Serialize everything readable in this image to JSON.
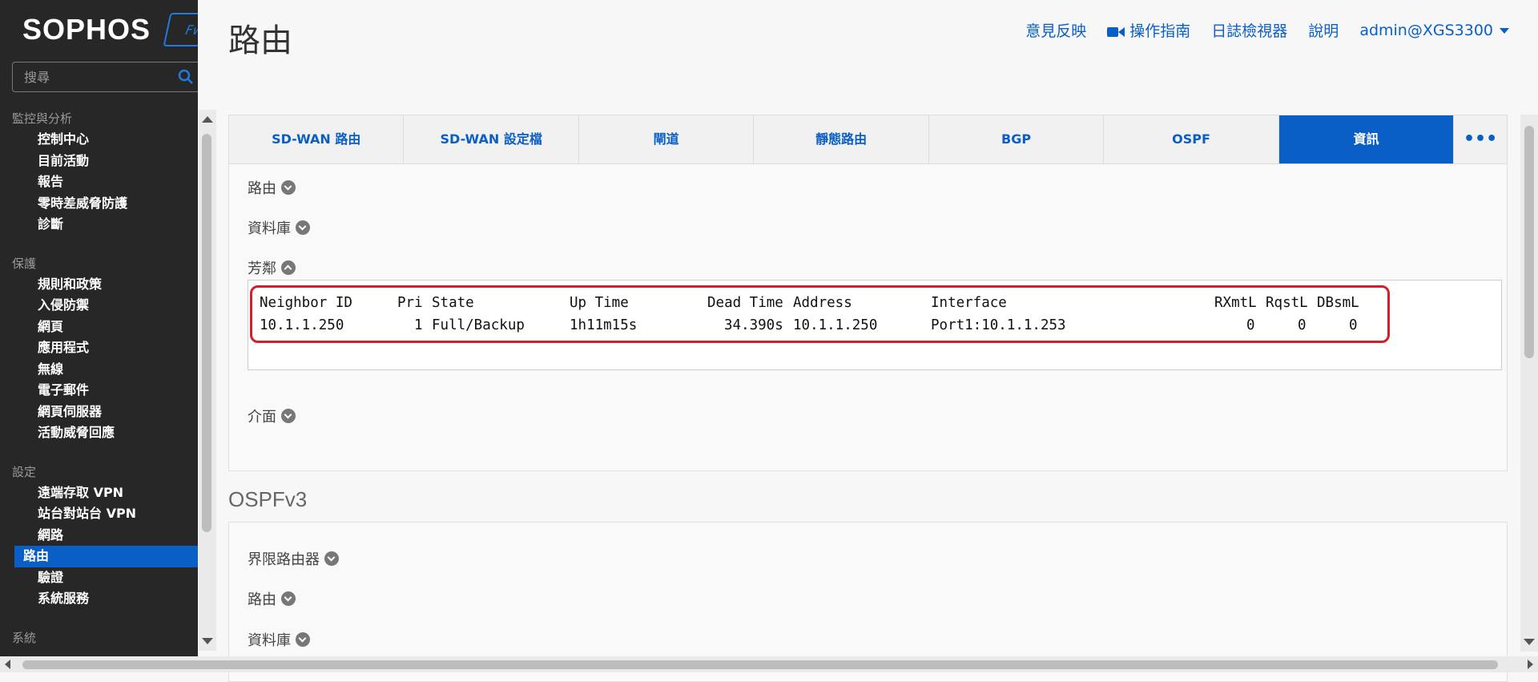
{
  "brand": {
    "name": "SOPHOS",
    "badge": "Fw"
  },
  "search": {
    "placeholder": "搜尋"
  },
  "sidebar": {
    "sections": [
      {
        "title": "監控與分析",
        "items": [
          "控制中心",
          "目前活動",
          "報告",
          "零時差威脅防護",
          "診斷"
        ]
      },
      {
        "title": "保護",
        "items": [
          "規則和政策",
          "入侵防禦",
          "網頁",
          "應用程式",
          "無線",
          "電子郵件",
          "網頁伺服器",
          "活動威脅回應"
        ]
      },
      {
        "title": "設定",
        "items": [
          "遠端存取 VPN",
          "站台對站台 VPN",
          "網路",
          "路由",
          "驗證",
          "系統服務"
        ]
      },
      {
        "title": "系統",
        "items": []
      }
    ],
    "active_item": "路由"
  },
  "header": {
    "title": "路由",
    "links": {
      "feedback": "意見反映",
      "guide": "操作指南",
      "log_viewer": "日誌檢視器",
      "help": "說明",
      "user": "admin@XGS3300"
    }
  },
  "tabs": [
    "SD-WAN 路由",
    "SD-WAN 設定檔",
    "閘道",
    "靜態路由",
    "BGP",
    "OSPF",
    "資訊"
  ],
  "active_tab": "資訊",
  "ospf_panel": {
    "sections": {
      "routes": "路由",
      "database": "資料庫",
      "neighbors": "芳鄰",
      "interfaces": "介面"
    },
    "neighbor_table": {
      "headers": [
        "Neighbor ID",
        "Pri",
        "State",
        "Up Time",
        "Dead Time",
        "Address",
        "Interface",
        "RXmtL",
        "RqstL",
        "DBsmL"
      ],
      "rows": [
        [
          "10.1.1.250",
          "1",
          "Full/Backup",
          "1h11m15s",
          "34.390s",
          "10.1.1.250",
          "Port1:10.1.1.253",
          "0",
          "0",
          "0"
        ]
      ]
    }
  },
  "ospfv3": {
    "title": "OSPFv3",
    "sections": {
      "border_routers": "界限路由器",
      "routes": "路由",
      "database": "資料庫"
    }
  },
  "colors": {
    "accent": "#0a5fc7",
    "sidebar_bg": "#272727",
    "highlight": "#d21f2b"
  }
}
